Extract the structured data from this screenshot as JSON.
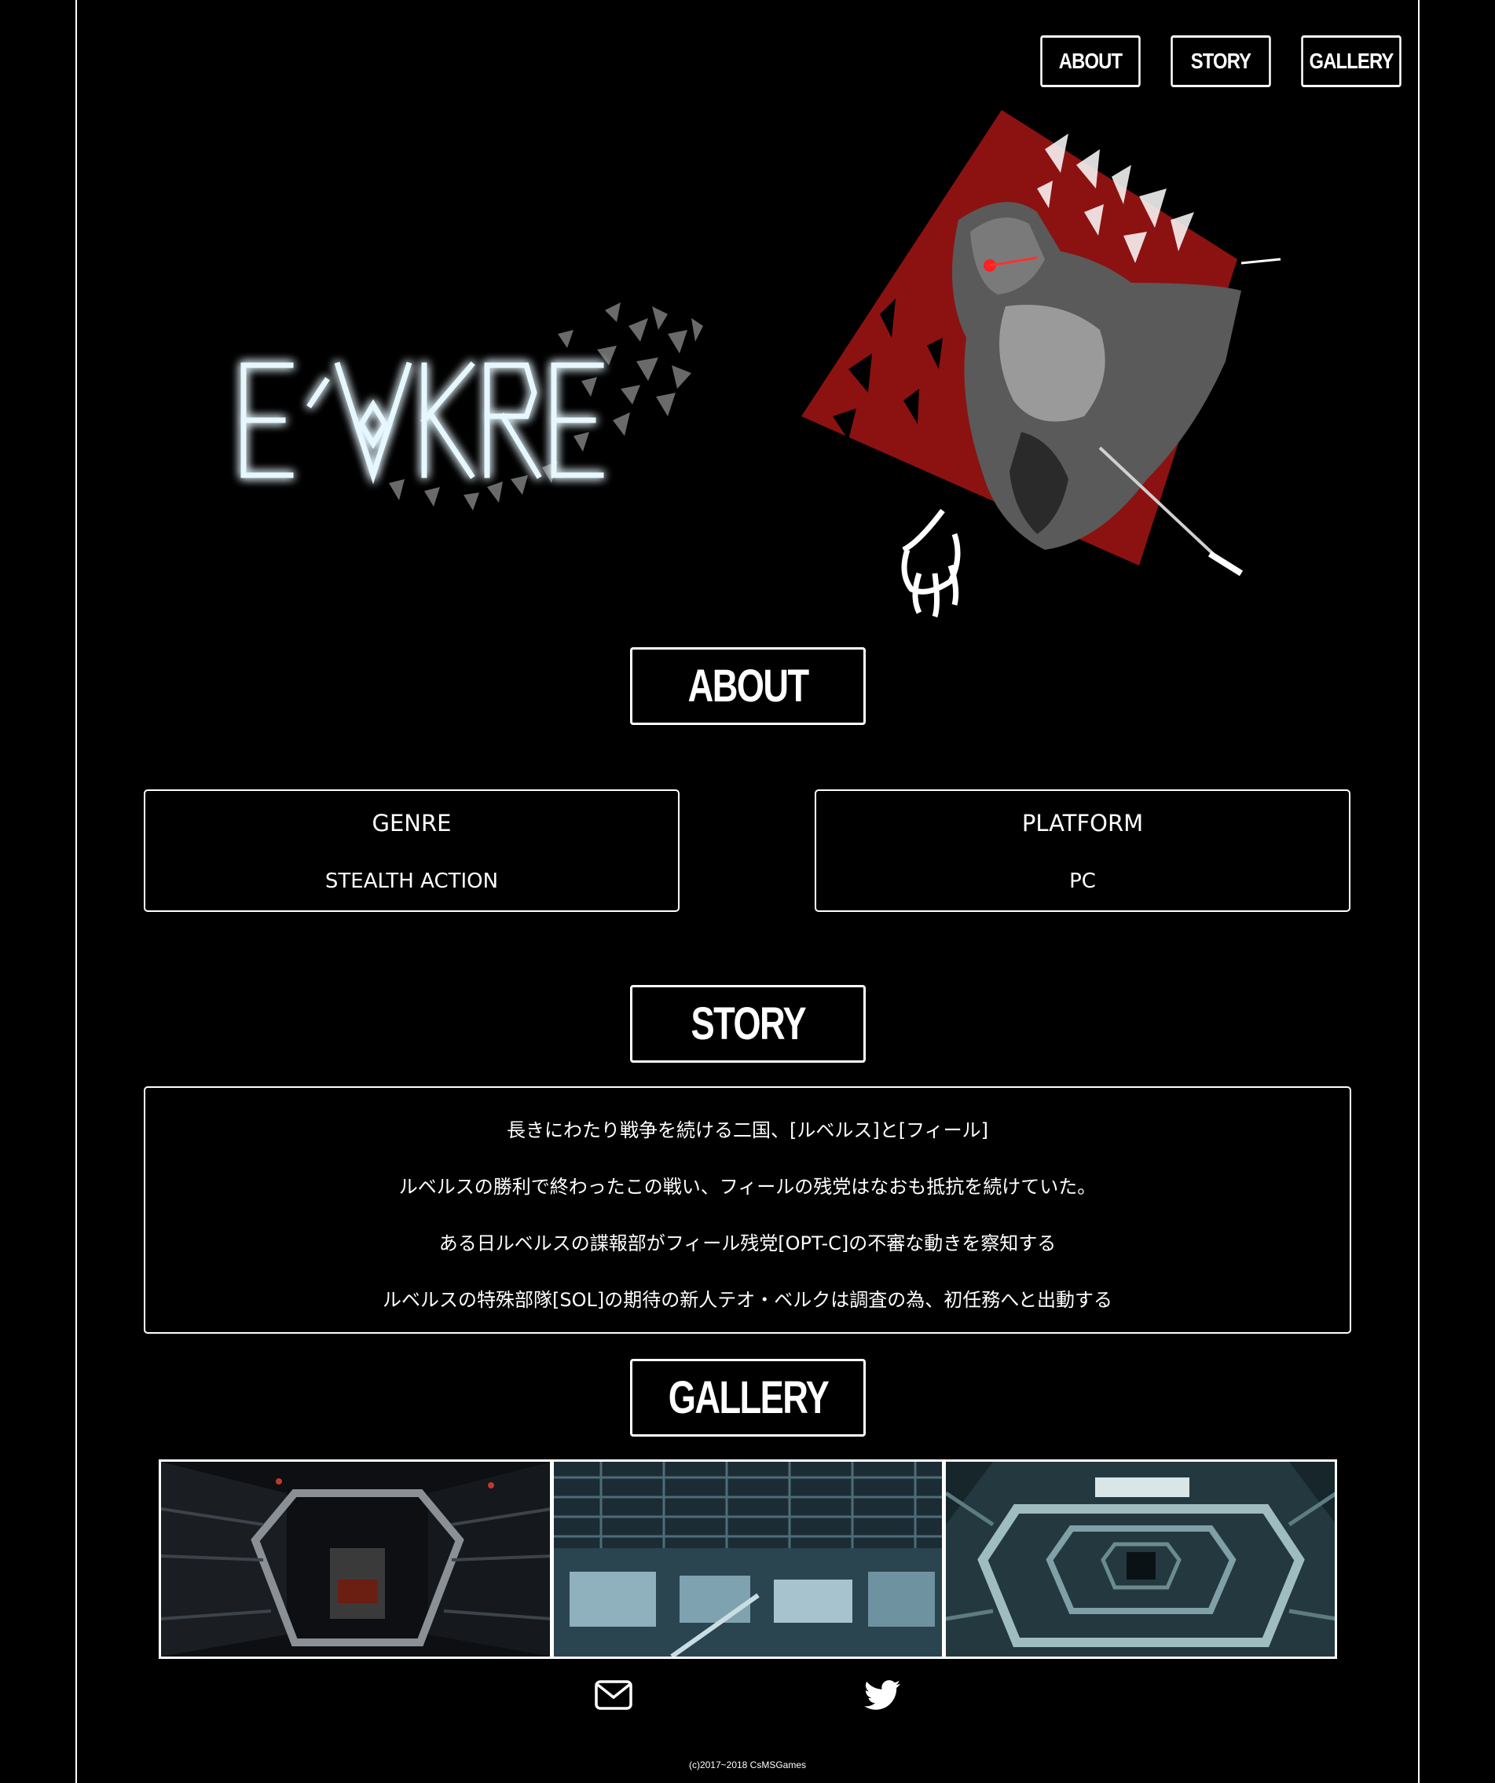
{
  "nav": {
    "items": [
      {
        "label": "ABOUT"
      },
      {
        "label": "STORY"
      },
      {
        "label": "GALLERY"
      }
    ]
  },
  "hero": {
    "logo_text": "E-VoKRE",
    "logo_glow_color": "#4fc9ff",
    "accent_red": "#8c1212"
  },
  "about": {
    "heading": "ABOUT",
    "cards": [
      {
        "title": "GENRE",
        "value": "STEALTH ACTION"
      },
      {
        "title": "PLATFORM",
        "value": "PC"
      }
    ]
  },
  "story": {
    "heading": "STORY",
    "lines": [
      "長きにわたり戦争を続ける二国、[ルベルス]と[フィール]",
      "ルベルスの勝利で終わったこの戦い、フィールの残党はなおも抵抗を続けていた。",
      "ある日ルベルスの諜報部がフィール残党[OPT-C]の不審な動きを察知する",
      "ルベルスの特殊部隊[SOL]の期待の新人テオ・ベルクは調査の為、初任務へと出動する"
    ]
  },
  "gallery": {
    "heading": "GALLERY"
  },
  "footer": {
    "icons": [
      "mail-icon",
      "twitter-icon"
    ],
    "copyright": "(c)2017~2018 CsMSGames"
  }
}
